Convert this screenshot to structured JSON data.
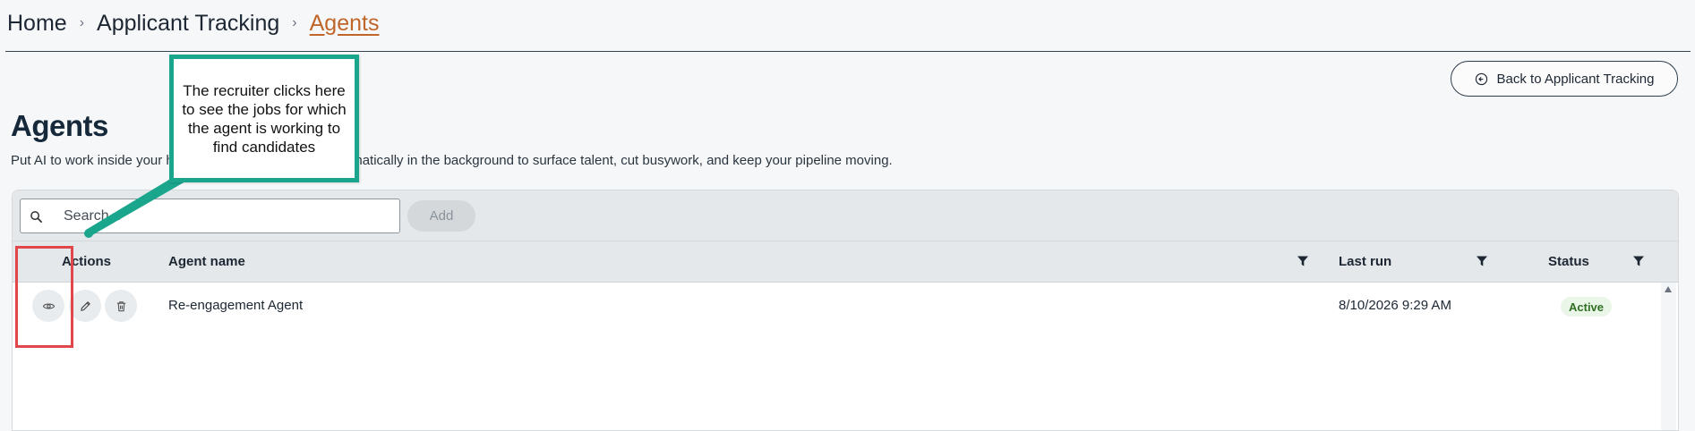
{
  "breadcrumb": {
    "items": [
      "Home",
      "Applicant Tracking"
    ],
    "current": "Agents",
    "separator": "›"
  },
  "back_button": {
    "label": "Back to Applicant Tracking",
    "icon": "arrow-left-circle-icon"
  },
  "page": {
    "title": "Agents",
    "description": "Put AI to work inside your hiring process. Agents run automatically in the background to surface talent, cut busywork, and keep your pipeline moving."
  },
  "toolbar": {
    "search_placeholder": "Search...",
    "add_label": "Add"
  },
  "table": {
    "columns": [
      "Actions",
      "Agent name",
      "Last run",
      "Status"
    ],
    "rows": [
      {
        "agent_name": "Re-engagement Agent",
        "last_run": "8/10/2026 9:29 AM",
        "status": "Active",
        "actions": [
          "view-icon",
          "edit-icon",
          "delete-icon"
        ]
      }
    ]
  },
  "annotation": {
    "text": "The recruiter clicks here to see the jobs for which the agent is working to find candidates",
    "border_color": "#1aa58d",
    "highlight_color": "#e0464a"
  },
  "colors": {
    "accent_link": "#c0662a",
    "status_active_bg": "#eaf6e7",
    "status_active_text": "#2f6f23"
  }
}
